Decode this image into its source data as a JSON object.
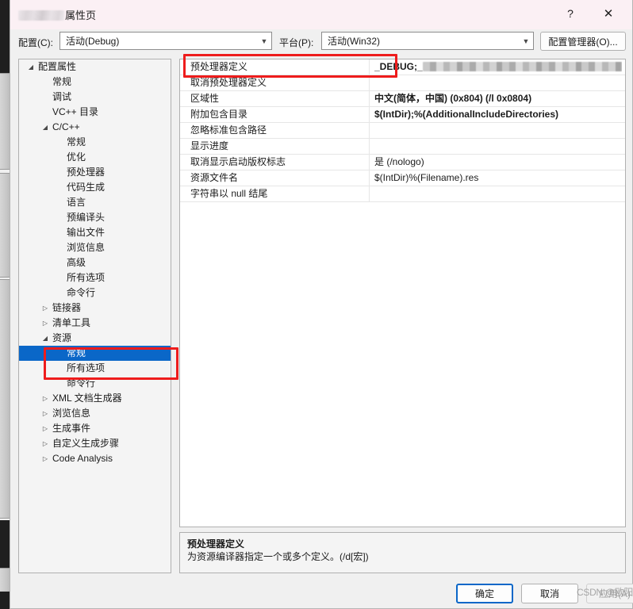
{
  "window": {
    "title_suffix": "属性页",
    "title_project_redacted": "",
    "help_icon": "question-mark-icon",
    "close_icon": "close-x-icon"
  },
  "config_bar": {
    "configuration_label": "配置(C):",
    "configuration_value": "活动(Debug)",
    "platform_label": "平台(P):",
    "platform_value": "活动(Win32)",
    "config_manager_button": "配置管理器(O)...",
    "dropdown_icon": "chevron-down-icon"
  },
  "tree": {
    "nodes": [
      {
        "label": "配置属性",
        "indent": 0,
        "twisty": "expanded",
        "selected": false
      },
      {
        "label": "常规",
        "indent": 1,
        "twisty": "none",
        "selected": false
      },
      {
        "label": "调试",
        "indent": 1,
        "twisty": "none",
        "selected": false
      },
      {
        "label": "VC++ 目录",
        "indent": 1,
        "twisty": "none",
        "selected": false
      },
      {
        "label": "C/C++",
        "indent": 1,
        "twisty": "expanded",
        "selected": false
      },
      {
        "label": "常规",
        "indent": 2,
        "twisty": "none",
        "selected": false
      },
      {
        "label": "优化",
        "indent": 2,
        "twisty": "none",
        "selected": false
      },
      {
        "label": "预处理器",
        "indent": 2,
        "twisty": "none",
        "selected": false
      },
      {
        "label": "代码生成",
        "indent": 2,
        "twisty": "none",
        "selected": false
      },
      {
        "label": "语言",
        "indent": 2,
        "twisty": "none",
        "selected": false
      },
      {
        "label": "预编译头",
        "indent": 2,
        "twisty": "none",
        "selected": false
      },
      {
        "label": "输出文件",
        "indent": 2,
        "twisty": "none",
        "selected": false
      },
      {
        "label": "浏览信息",
        "indent": 2,
        "twisty": "none",
        "selected": false
      },
      {
        "label": "高级",
        "indent": 2,
        "twisty": "none",
        "selected": false
      },
      {
        "label": "所有选项",
        "indent": 2,
        "twisty": "none",
        "selected": false
      },
      {
        "label": "命令行",
        "indent": 2,
        "twisty": "none",
        "selected": false
      },
      {
        "label": "链接器",
        "indent": 1,
        "twisty": "collapsed",
        "selected": false
      },
      {
        "label": "清单工具",
        "indent": 1,
        "twisty": "collapsed",
        "selected": false
      },
      {
        "label": "资源",
        "indent": 1,
        "twisty": "expanded",
        "selected": false
      },
      {
        "label": "常规",
        "indent": 2,
        "twisty": "none",
        "selected": true
      },
      {
        "label": "所有选项",
        "indent": 2,
        "twisty": "none",
        "selected": false
      },
      {
        "label": "命令行",
        "indent": 2,
        "twisty": "none",
        "selected": false
      },
      {
        "label": "XML 文档生成器",
        "indent": 1,
        "twisty": "collapsed",
        "selected": false
      },
      {
        "label": "浏览信息",
        "indent": 1,
        "twisty": "collapsed",
        "selected": false
      },
      {
        "label": "生成事件",
        "indent": 1,
        "twisty": "collapsed",
        "selected": false
      },
      {
        "label": "自定义生成步骤",
        "indent": 1,
        "twisty": "collapsed",
        "selected": false
      },
      {
        "label": "Code Analysis",
        "indent": 1,
        "twisty": "collapsed",
        "selected": false
      }
    ]
  },
  "grid": {
    "rows": [
      {
        "name": "预处理器定义",
        "value": "_DEBUG;_",
        "bold": true,
        "redacted": true
      },
      {
        "name": "取消预处理器定义",
        "value": "",
        "bold": false,
        "redacted": false
      },
      {
        "name": "区域性",
        "value": "中文(简体，中国) (0x804) (/l 0x0804)",
        "bold": true,
        "redacted": false
      },
      {
        "name": "附加包含目录",
        "value": "$(IntDir);%(AdditionalIncludeDirectories)",
        "bold": true,
        "redacted": false
      },
      {
        "name": "忽略标准包含路径",
        "value": "",
        "bold": false,
        "redacted": false
      },
      {
        "name": "显示进度",
        "value": "",
        "bold": false,
        "redacted": false
      },
      {
        "name": "取消显示启动版权标志",
        "value": "是 (/nologo)",
        "bold": false,
        "redacted": false
      },
      {
        "name": "资源文件名",
        "value": "$(IntDir)%(Filename).res",
        "bold": false,
        "redacted": false
      },
      {
        "name": "字符串以 null 结尾",
        "value": "",
        "bold": false,
        "redacted": false
      }
    ]
  },
  "description": {
    "title": "预处理器定义",
    "body": "为资源编译器指定一个或多个定义。(/d[宏])"
  },
  "footer": {
    "ok_label": "确定",
    "cancel_label": "取消",
    "apply_label": "应用(A)",
    "watermark": "CSDN @欧阳坚"
  },
  "annotations": {
    "accent_color": "#ee1c1c",
    "items": [
      {
        "name": "preprocessor-definitions-row"
      },
      {
        "name": "resource-general-node"
      }
    ]
  },
  "colors": {
    "titlebar": "#fbf0f4",
    "selection_blue": "#0a67c8",
    "dialog_bg": "#f0f0f0",
    "grid_bg": "#ffffff"
  }
}
